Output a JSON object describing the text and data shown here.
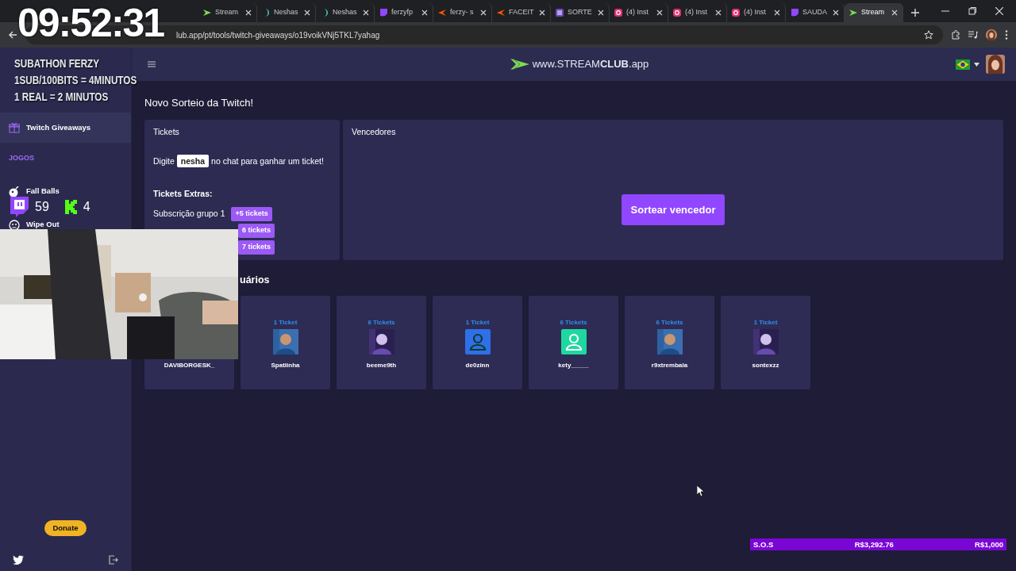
{
  "browser": {
    "tabs": [
      {
        "label": "Stream",
        "selected": false
      },
      {
        "label": "Neshas",
        "selected": false
      },
      {
        "label": "Neshas",
        "selected": false
      },
      {
        "label": "ferzyfp",
        "selected": false
      },
      {
        "label": "ferzy- s",
        "selected": false
      },
      {
        "label": "FACEIT",
        "selected": false
      },
      {
        "label": "SORTE",
        "selected": false
      },
      {
        "label": "(4) Inst",
        "selected": false
      },
      {
        "label": "(4) Inst",
        "selected": false
      },
      {
        "label": "(4) Inst",
        "selected": false
      },
      {
        "label": "SAUDA",
        "selected": false
      },
      {
        "label": "Stream",
        "selected": true
      }
    ],
    "url": "lub.app/pt/tools/twitch-giveaways/o19voikVNj5TKL7yahag"
  },
  "header": {
    "logo": "www.STREAM**CLUB**.app"
  },
  "sidebar": {
    "items": [
      {
        "kind": "item",
        "label": "Twitch Giveaways",
        "selected": true
      },
      {
        "kind": "heading",
        "label": "JOGOS"
      },
      {
        "kind": "item",
        "label": "Fall Balls",
        "selected": false
      },
      {
        "kind": "item",
        "label": "Wipe Out",
        "selected": false
      }
    ],
    "donate": "Donate"
  },
  "main": {
    "title": "Novo Sorteio da Twitch!",
    "tickets": {
      "title": "Tickets",
      "prefix": "Digite",
      "keyword": "nesha",
      "suffix": "no chat para ganhar um ticket!",
      "extras_title": "Tickets Extras:",
      "extras": [
        {
          "label": "Subscrição grupo 1",
          "badge": "+5 tickets"
        },
        {
          "badge": "6 tickets"
        },
        {
          "badge": "7 tickets"
        }
      ]
    },
    "winners": {
      "title": "Vencedores",
      "button": "Sortear vencedor"
    },
    "participants_title": "uários",
    "users": [
      {
        "name": "DAVIBORGESK_"
      },
      {
        "tickets": "1 Ticket",
        "name": "Spatiinha",
        "kind": "picture"
      },
      {
        "tickets": "6 Tickets",
        "name": "beeme9th",
        "kind": "picture"
      },
      {
        "tickets": "1 Ticket",
        "name": "de0zinn",
        "kind": "default",
        "color": "#2f6fe8"
      },
      {
        "tickets": "6 Tickets",
        "name": "kety_____",
        "kind": "default",
        "color": "#1ed8a0"
      },
      {
        "tickets": "6 Tickets",
        "name": "r9xtrembala",
        "kind": "picture"
      },
      {
        "tickets": "1 Ticket",
        "name": "sontexzz",
        "kind": "picture"
      }
    ]
  },
  "overlay": {
    "timer": "09:52:31",
    "subathon": [
      "SUBATHON FERZY",
      "1SUB/100BITS = 4MINUTOS",
      "1 REAL = 2 MINUTOS"
    ],
    "counters": [
      "59",
      "4"
    ],
    "goal": {
      "label": "S.O.S",
      "current": "R$3,292.76",
      "target": "R$1,000",
      "level": 1
    }
  }
}
